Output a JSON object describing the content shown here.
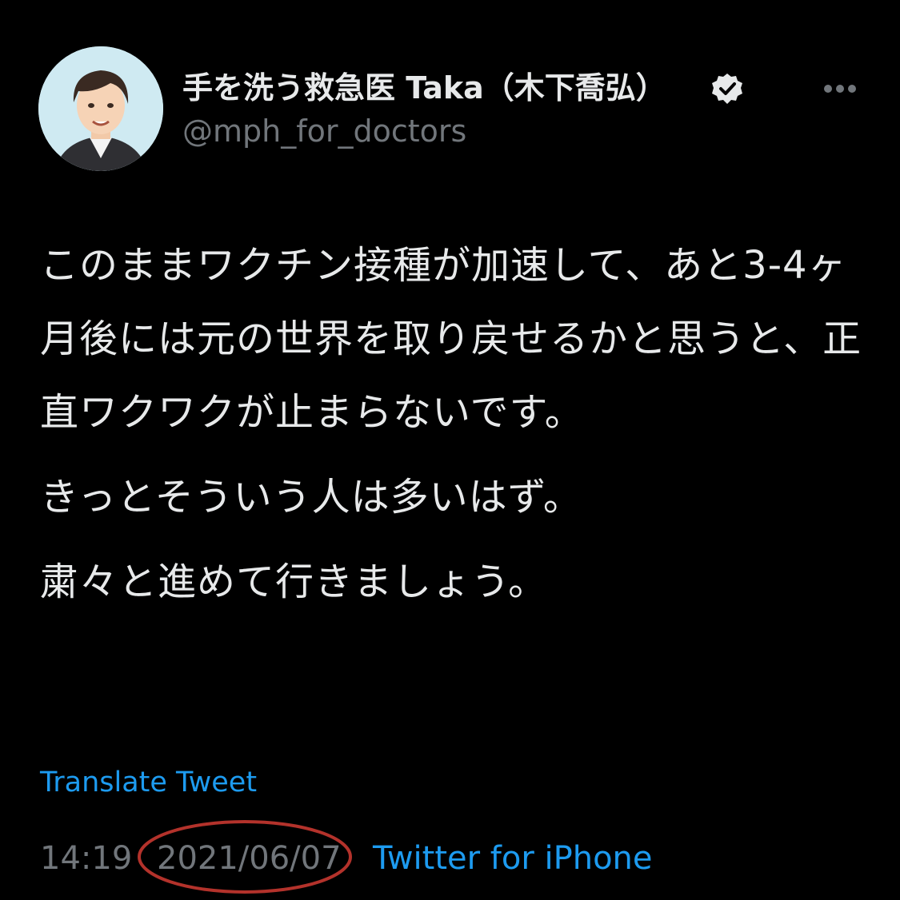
{
  "author": {
    "display_name": "手を洗う救急医 Taka（木下喬弘）",
    "handle": "@mph_for_doctors",
    "verified_icon": "verified-badge-icon",
    "more_icon": "ellipsis-icon"
  },
  "tweet": {
    "paragraphs": [
      "このままワクチン接種が加速して、あと3-4ヶ月後には元の世界を取り戻せるかと思うと、正直ワクワクが止まらないです。",
      "きっとそういう人は多いはず。",
      "粛々と進めて行きましょう。"
    ],
    "translate_label": "Translate Tweet"
  },
  "meta": {
    "time": "14:19",
    "date": "2021/06/07",
    "source": "Twitter for iPhone"
  },
  "colors": {
    "background": "#000000",
    "text": "#e7e9ea",
    "muted": "#71767b",
    "link": "#1d9bf0",
    "annotation": "#b3322b"
  }
}
